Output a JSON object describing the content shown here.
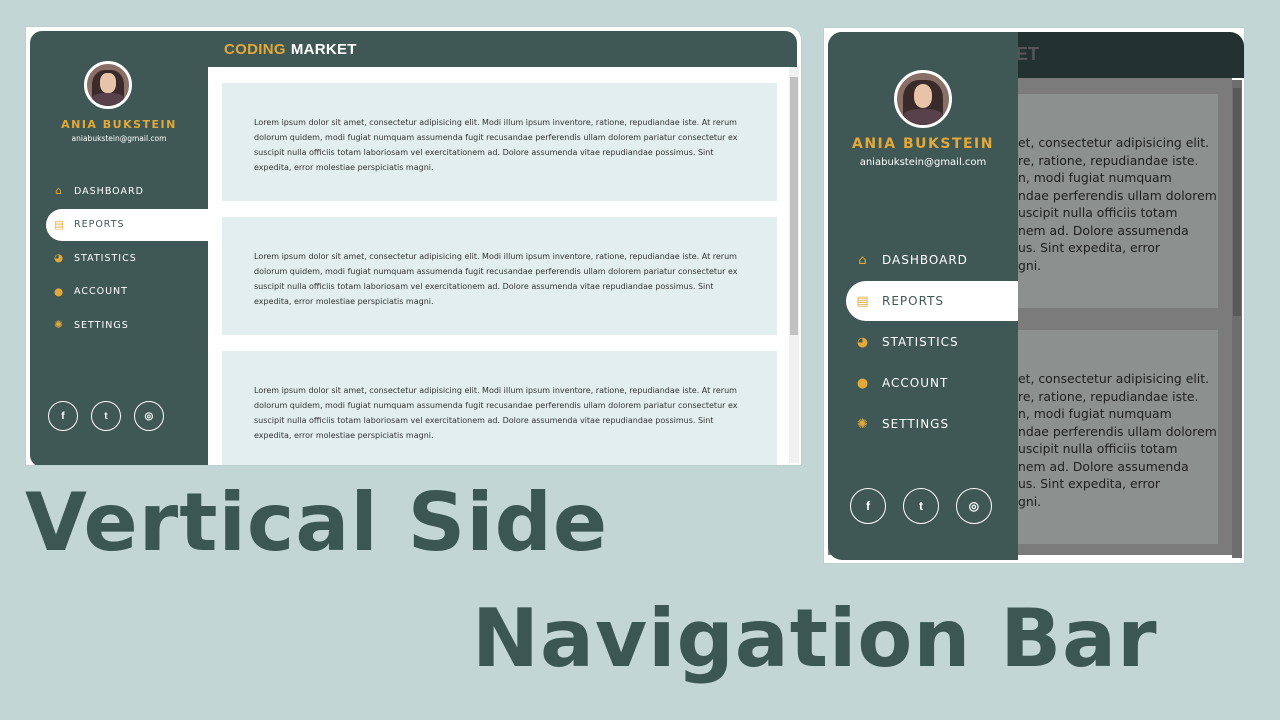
{
  "brand": {
    "part1": "CODING",
    "part2": "MARKET"
  },
  "user": {
    "name": "ANIA BUKSTEIN",
    "email": "aniabukstein@gmail.com"
  },
  "nav": [
    {
      "label": "DASHBOARD",
      "icon": "home-icon",
      "glyph": "⌂"
    },
    {
      "label": "REPORTS",
      "icon": "file-icon",
      "glyph": "▤"
    },
    {
      "label": "STATISTICS",
      "icon": "pie-chart-icon",
      "glyph": "◕"
    },
    {
      "label": "ACCOUNT",
      "icon": "user-icon",
      "glyph": "●"
    },
    {
      "label": "SETTINGS",
      "icon": "gear-icon",
      "glyph": "✺"
    }
  ],
  "active_nav": "REPORTS",
  "social": [
    {
      "name": "facebook-icon",
      "glyph": "f"
    },
    {
      "name": "twitter-icon",
      "glyph": "t"
    },
    {
      "name": "instagram-icon",
      "glyph": "◎"
    }
  ],
  "card_text": "Lorem ipsum dolor sit amet, consectetur adipisicing elit. Modi illum ipsum inventore, ratione, repudiandae iste. At rerum dolorum quidem, modi fugiat numquam assumenda fugit recusandae perferendis ullam dolorem pariatur consectetur ex suscipit nulla officiis totam laboriosam vel exercitationem ad. Dolore assumenda vitae repudiandae possimus. Sint expedita, error molestiae perspiciatis magni.",
  "mobile_ghost_title": "ET",
  "mobile_card1_lines": [
    "et, consectetur adipisicing elit.",
    "re, ratione, repudiandae iste.",
    "n, modi fugiat numquam",
    "ndae perferendis ullam dolorem",
    "uscipit nulla officiis totam",
    "nem ad. Dolore assumenda",
    "us. Sint expedita, error",
    "gni."
  ],
  "mobile_card2_lines": [
    "et, consectetur adipisicing elit.",
    "re, ratione, repudiandae iste.",
    "n, modi fugiat numquam",
    "ndae perferendis ullam dolorem",
    "uscipit nulla officiis totam",
    "nem ad. Dolore assumenda",
    "us. Sint expedita, error",
    "gni."
  ],
  "title": {
    "line1": "Vertical Side",
    "line2": "Navigation Bar"
  },
  "colors": {
    "sidebar": "#3f5855",
    "accent": "#e2a93a",
    "card": "#e2efee",
    "background": "#c2d6d5"
  }
}
